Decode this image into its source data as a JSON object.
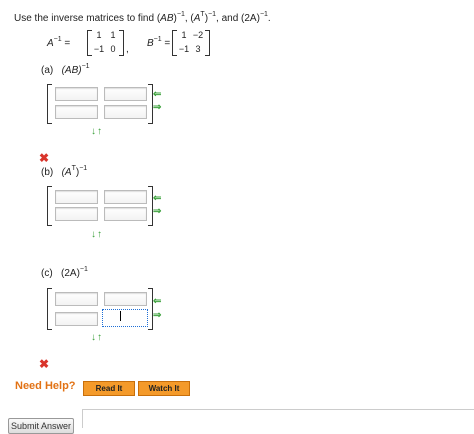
{
  "question": {
    "intro": "Use the inverse matrices to find (",
    "prompt_suffix": ", and (2A)"
  },
  "matrices": {
    "a_label": "A",
    "b_label": "B",
    "a_values": [
      "1",
      "1",
      "−1",
      "0"
    ],
    "b_values": [
      "1",
      "−2",
      "−1",
      "3"
    ]
  },
  "parts": [
    {
      "letter": "(a)",
      "expr": "(AB)"
    },
    {
      "letter": "(b)",
      "expr": "(A"
    },
    {
      "letter": "(c)",
      "expr": "(2A)"
    }
  ],
  "superscripts": {
    "neg_one": "−1",
    "t": "T"
  },
  "controls": {
    "left_arrow": "⇐",
    "right_arrow": "⇒",
    "down_arrow": "↓",
    "up_arrow": "↑",
    "x_mark": "✖"
  },
  "help": {
    "label": "Need Help?",
    "read_it": "Read It",
    "watch_it": "Watch It"
  },
  "submit_label": "Submit Answer"
}
